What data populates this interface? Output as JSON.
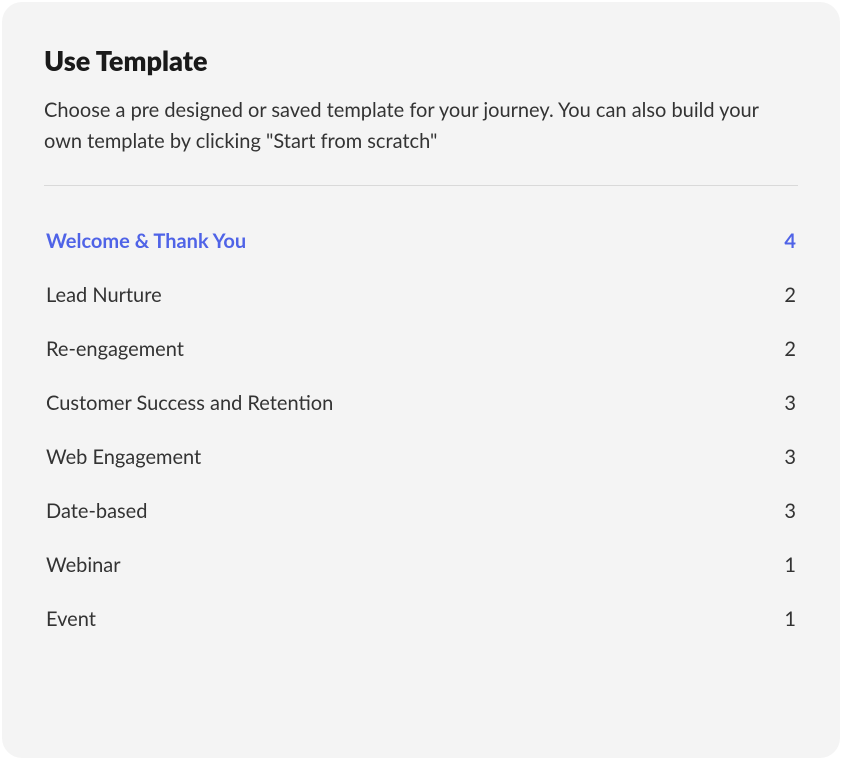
{
  "header": {
    "title": "Use Template",
    "description": "Choose a pre designed or saved template for your journey. You can also build your own template by clicking \"Start from scratch\""
  },
  "categories": [
    {
      "label": "Welcome & Thank You",
      "count": 4,
      "active": true
    },
    {
      "label": "Lead Nurture",
      "count": 2,
      "active": false
    },
    {
      "label": "Re-engagement",
      "count": 2,
      "active": false
    },
    {
      "label": "Customer Success and Retention",
      "count": 3,
      "active": false
    },
    {
      "label": "Web Engagement",
      "count": 3,
      "active": false
    },
    {
      "label": "Date-based",
      "count": 3,
      "active": false
    },
    {
      "label": "Webinar",
      "count": 1,
      "active": false
    },
    {
      "label": "Event",
      "count": 1,
      "active": false
    }
  ]
}
